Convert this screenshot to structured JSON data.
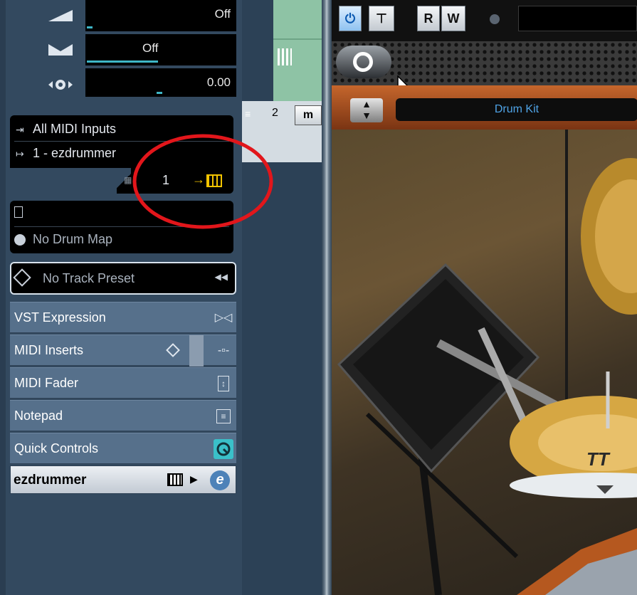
{
  "inspector": {
    "controls": [
      {
        "icon": "volume-icon",
        "value": "Off"
      },
      {
        "icon": "pan-icon",
        "value": "Off"
      },
      {
        "icon": "delay-icon",
        "value": "0.00"
      }
    ],
    "routing": {
      "input": "All MIDI Inputs",
      "output": "1 - ezdrummer",
      "channel": "1"
    },
    "drum_map": {
      "map_label": "No Drum Map"
    },
    "track_preset": "No Track Preset",
    "sections": [
      {
        "label": "VST Expression",
        "icon": "expression-icon"
      },
      {
        "label": "MIDI Inserts",
        "icon": "insert-icon"
      },
      {
        "label": "MIDI Fader",
        "icon": "fader-icon"
      },
      {
        "label": "Notepad",
        "icon": "notepad-icon"
      },
      {
        "label": "Quick Controls",
        "icon": "quick-controls-icon"
      }
    ],
    "instrument": "ezdrummer"
  },
  "tracks": {
    "track_number": "2",
    "mute_label": "m"
  },
  "plugin": {
    "toolbar": {
      "read": "R",
      "write": "W"
    },
    "kit_title": "Drum Kit",
    "logo_text": "TT"
  },
  "colors": {
    "accent": "#3eb6c7",
    "highlight_circle": "#e2161b",
    "route_arrow": "#f2c400"
  }
}
